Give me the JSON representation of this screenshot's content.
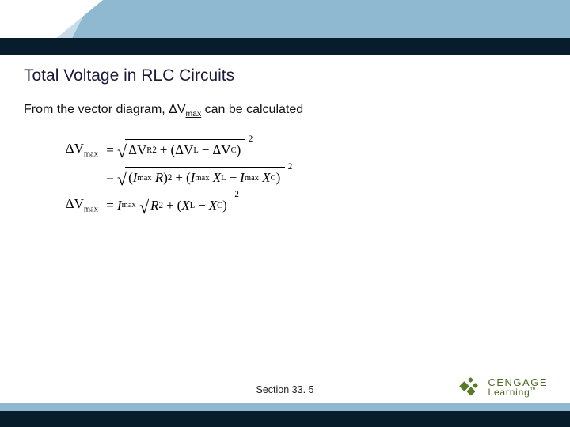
{
  "title": "Total Voltage in RLC Circuits",
  "body": {
    "prefix": "From the vector diagram, ΔV",
    "sub": "max",
    "suffix": " can be calculated"
  },
  "equations": {
    "lhs1": "ΔV",
    "lhs1_sub": "max",
    "rhs1_a": "ΔV",
    "rhs1_a_sub": "R",
    "rhs1_a_sup": "2",
    "rhs1_b": "ΔV",
    "rhs1_b_sub": "L",
    "rhs1_c": "ΔV",
    "rhs1_c_sub": "C",
    "rhs1_outer_sup": "2",
    "rhs2_aI": "I",
    "rhs2_a_sub": "max",
    "rhs2_aR": "R",
    "rhs2_a_sup": "2",
    "rhs2_bI": "I",
    "rhs2_b_sub": "max",
    "rhs2_bX": "X",
    "rhs2_bX_sub": "L",
    "rhs2_cI": "I",
    "rhs2_c_sub": "max",
    "rhs2_cX": "X",
    "rhs2_cX_sub": "C",
    "rhs2_outer_sup": "2",
    "lhs3": "ΔV",
    "lhs3_sub": "max",
    "rhs3_I": "I",
    "rhs3_I_sub": "max",
    "rhs3_R": "R",
    "rhs3_R_sup": "2",
    "rhs3_XL": "X",
    "rhs3_XL_sub": "L",
    "rhs3_XC": "X",
    "rhs3_XC_sub": "C",
    "rhs3_outer_sup": "2"
  },
  "section": "Section  33. 5",
  "logo": {
    "brand": "CENGAGE",
    "sub": "Learning",
    "tm": "™"
  }
}
